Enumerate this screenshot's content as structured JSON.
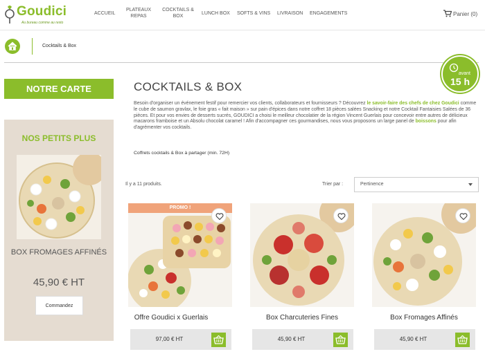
{
  "brand": {
    "name": "Goudici",
    "tagline": "Au bureau comme au resto"
  },
  "nav": {
    "items": [
      {
        "label": "ACCUEIL"
      },
      {
        "label": "PLATEAUX REPAS"
      },
      {
        "label": "COCKTAILS & BOX"
      },
      {
        "label": "LUNCH BOX"
      },
      {
        "label": "SOFTS & VINS"
      },
      {
        "label": "LIVRAISON"
      },
      {
        "label": "ENGAGEMENTS"
      }
    ],
    "cart": "Panier (0)"
  },
  "breadcrumb": {
    "current": "Cocktails & Box"
  },
  "badge": {
    "small": "avant",
    "big": "15 h"
  },
  "sidebar": {
    "carte_button": "NOTRE CARTE",
    "petits_title": "NOS PETITS PLUS",
    "product_name": "BOX FROMAGES AFFINÉS",
    "product_price": "45,90 € HT",
    "order_button": "Commandez"
  },
  "main": {
    "title": "COCKTAILS & BOX",
    "desc_1": "Besoin d'organiser un événement festif pour remercier vos clients, collaborateurs et fournisseurs ? Découvrez ",
    "desc_link_1": "le savoir-faire des chefs de chez Goudici",
    "desc_2": " comme le cube de saumon gravlax, le foie gras « fait maison » sur pain d'épices dans  notre coffret 18 pièces salées Snacking et notre Cocktail Fantaisies Salées de 36 pièces. Et pour vos envies de desserts sucrés, GOUDICI a choisi le meilleur chocolatier de la région Vincent Guerlais pour concevoir entre autres de délicieux macarons framboise et un Absolu chocolat caramel ! Afin d'accompagner ces gourmandises, nous vous proposons un large panel de ",
    "desc_link_2": "boissons",
    "desc_3": " pour afin d'agrémenter vos cocktails.",
    "subline": "Coffrets cocktails & Box à partager (min. 72H)",
    "count": "Il y a 11 produits.",
    "sort_label": "Trier par :",
    "sort_value": "Pertinence"
  },
  "products": [
    {
      "name": "Offre Goudici x Guerlais",
      "price": "97,00 € HT",
      "badge": "PROMO !"
    },
    {
      "name": "Box Charcuteries Fines",
      "price": "45,90 € HT"
    },
    {
      "name": "Box Fromages Affinés",
      "price": "45,90 € HT"
    }
  ],
  "colors": {
    "accent": "#8bbd2b",
    "promo": "#f0a37a",
    "sidebar_bg": "#e5dcd1"
  }
}
